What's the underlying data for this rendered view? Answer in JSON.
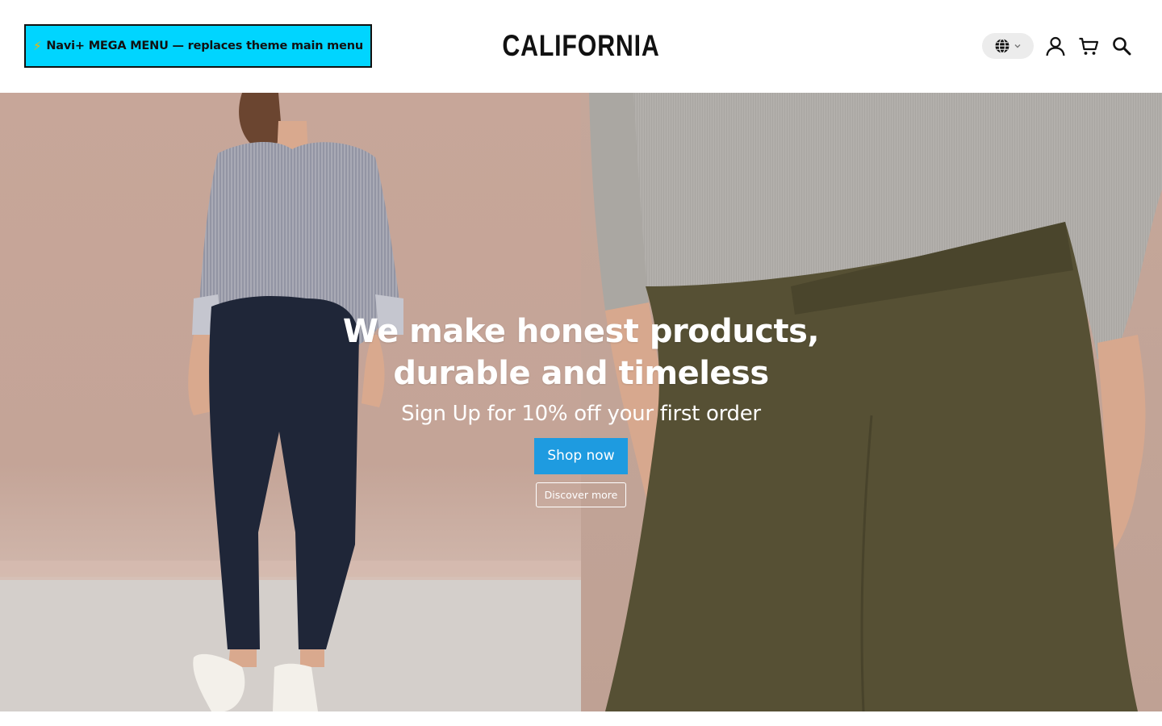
{
  "header": {
    "mega_menu_label": "Navi+ MEGA MENU — replaces theme main menu",
    "mega_menu_icon": "lightning-icon",
    "logo_text": "CALIFORNIA",
    "icons": [
      "globe-icon",
      "chevron-down-icon",
      "account-icon",
      "cart-icon",
      "search-icon"
    ]
  },
  "hero": {
    "title_line1": "We make honest products,",
    "title_line2": "durable and timeless",
    "subtitle": "Sign Up for 10% off your first order",
    "primary_button": "Shop now",
    "secondary_button": "Discover more"
  },
  "colors": {
    "mega_menu_bg": "#00d5ff",
    "primary_button_bg": "#1e9be0",
    "hero_bg": "#c5a79a"
  }
}
